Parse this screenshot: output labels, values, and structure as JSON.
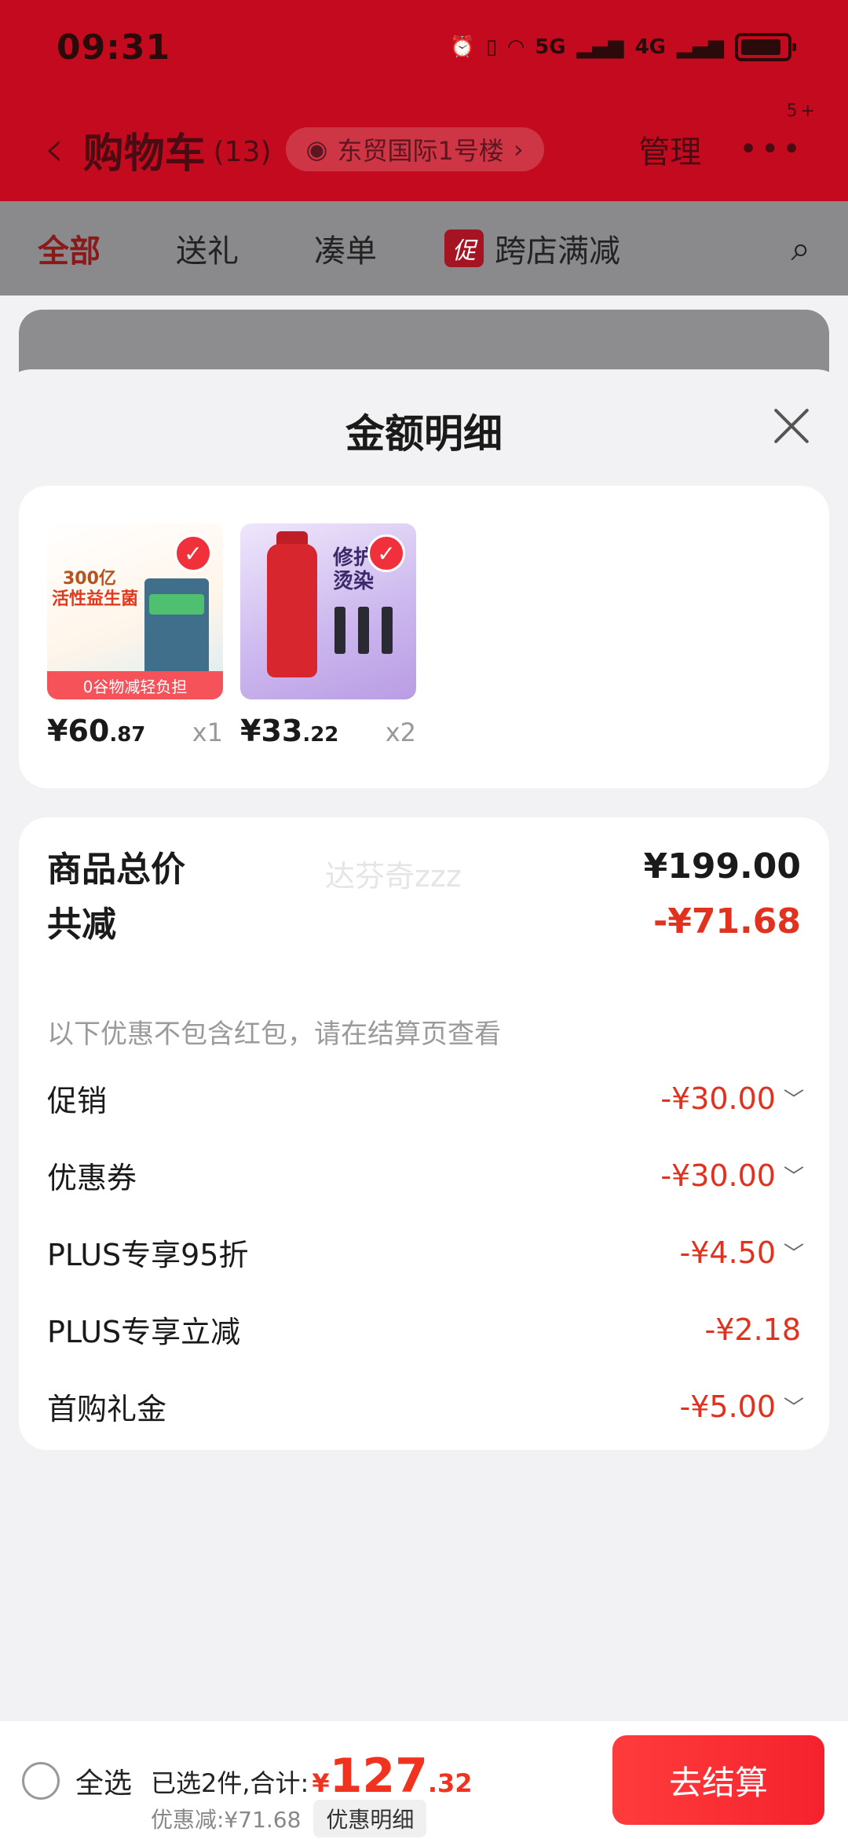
{
  "status_bar": {
    "time": "09:31",
    "net_5g": "5G",
    "net_4g": "4G"
  },
  "nav": {
    "title": "购物车",
    "count": "(13)",
    "address": "东贸国际1号楼",
    "manage": "管理",
    "more_badge": "5+"
  },
  "tabs": {
    "all": "全部",
    "gift": "送礼",
    "bundle": "凑单",
    "promo_tag": "促",
    "cross_store": "跨店满减"
  },
  "sheet": {
    "title": "金额明细",
    "products": [
      {
        "price_int": "¥60",
        "price_dec": ".87",
        "qty": "x1",
        "img_text_1": "300亿",
        "img_text_2": "活性益生菌",
        "img_strip": "0谷物减轻负担"
      },
      {
        "price_int": "¥33",
        "price_dec": ".22",
        "qty": "x2",
        "img_text_1": "修护",
        "img_text_2": "烫染"
      }
    ],
    "details": {
      "total_label": "商品总价",
      "total_value": "¥199.00",
      "watermark": "达芬奇zzz",
      "reduce_label": "共减",
      "reduce_value": "-¥71.68",
      "note": "以下优惠不包含红包，请在结算页查看",
      "items": [
        {
          "label": "促销",
          "value": "-¥30.00"
        },
        {
          "label": "优惠券",
          "value": "-¥30.00"
        },
        {
          "label": "PLUS专享95折",
          "value": "-¥4.50"
        },
        {
          "label": "PLUS专享立减",
          "value": "-¥2.18"
        },
        {
          "label": "首购礼金",
          "value": "-¥5.00"
        }
      ]
    }
  },
  "bottom": {
    "select_all": "全选",
    "selected_text": "已选2件,合计:",
    "currency": "¥",
    "total_int": "127",
    "total_dec": ".32",
    "discount_text": "优惠减:¥71.68",
    "detail_button": "优惠明细",
    "checkout": "去结算"
  },
  "colors": {
    "brand_red": "#c40a1e",
    "price_red": "#e0321e"
  }
}
